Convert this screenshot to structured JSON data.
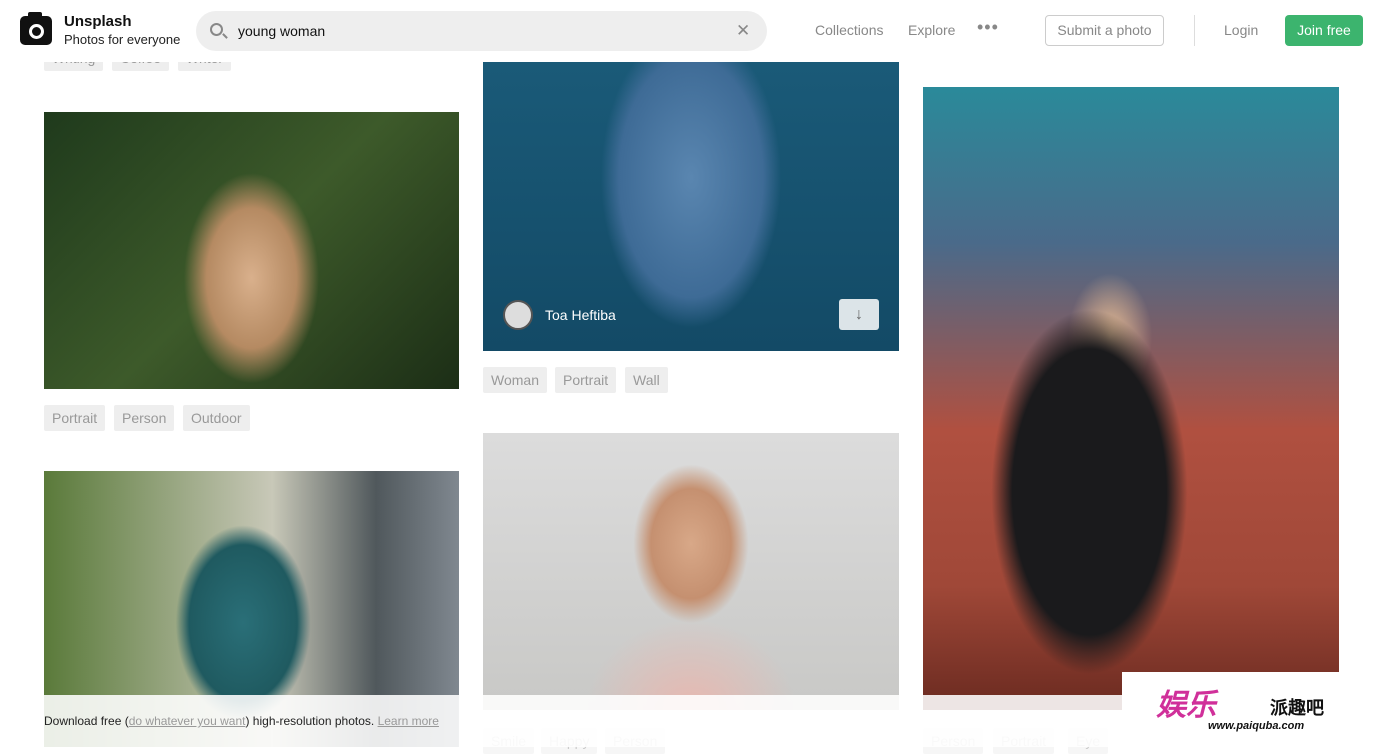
{
  "header": {
    "brand": "Unsplash",
    "tagline": "Photos for everyone",
    "search_value": "young woman",
    "nav": [
      "Collections",
      "Explore"
    ],
    "submit": "Submit a photo",
    "login": "Login",
    "join": "Join free",
    "join_color": "#3cb46e"
  },
  "columns": [
    {
      "items": [
        {
          "tags": [
            "Writing",
            "Coffee",
            "Writer"
          ]
        },
        {
          "tags": [
            "Portrait",
            "Person",
            "Outdoor"
          ]
        },
        {
          "tags": []
        }
      ]
    },
    {
      "items": [
        {
          "author": "Toa Heftiba",
          "tags": [
            "Woman",
            "Portrait",
            "Wall"
          ]
        },
        {
          "tags": [
            "Smile",
            "Happy",
            "Person"
          ]
        }
      ]
    },
    {
      "items": [
        {
          "tags": [
            "Person",
            "Portrait",
            "Eye"
          ]
        }
      ]
    }
  ],
  "footer": {
    "prefix": "Download free (",
    "link": "do whatever you want",
    "suffix": ") high-resolution photos.",
    "learn": "Learn more"
  },
  "watermark": {
    "logo": "娱乐",
    "name": "派趣吧",
    "url": "www.paiquba.com"
  }
}
